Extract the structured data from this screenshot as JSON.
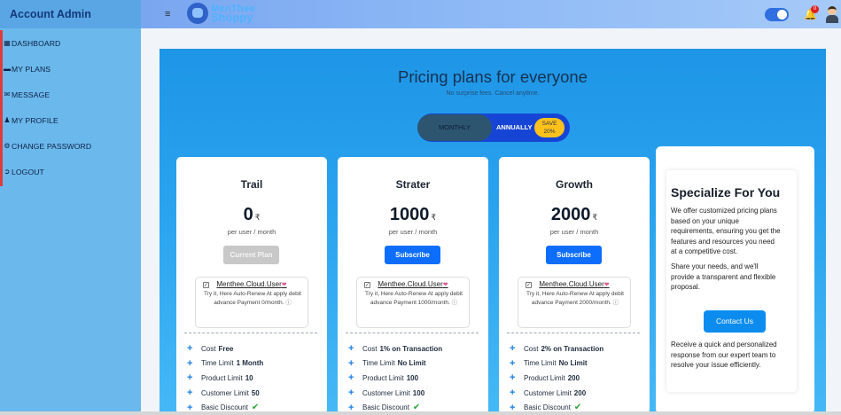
{
  "sidebar": {
    "title": "Account Admin",
    "items": [
      {
        "icon": "dashboard-icon",
        "label": "DASHBOARD"
      },
      {
        "icon": "card-icon",
        "label": "MY PLANS"
      },
      {
        "icon": "message-icon",
        "label": "MESSAGE"
      },
      {
        "icon": "user-icon",
        "label": "MY PROFILE"
      },
      {
        "icon": "gear-icon",
        "label": "CHANGE PASSWORD"
      },
      {
        "icon": "logout-icon",
        "label": "LOGOUT"
      }
    ]
  },
  "topbar": {
    "logo_line1": "MenThee",
    "logo_line2": "Shoppy",
    "notification_count": "0"
  },
  "pricing": {
    "headline": "Pricing plans for everyone",
    "subline": "No surprise fees. Cancel anytime.",
    "monthly_label": "MONTHLY",
    "annual_label": "ANNUALLY",
    "save_line1": "SAVE",
    "save_line2": "20%"
  },
  "plans": [
    {
      "name": "Trail",
      "price": "0",
      "currency": "₹",
      "per": "per user / month",
      "button": "Current Plan",
      "user_label": "Menthee.Cloud.User",
      "desc": "Try it, Here Auto-Renew At apply debit advance Payment 0/month.",
      "features": [
        {
          "label": "Cost",
          "value": "Free"
        },
        {
          "label": "Time Limit",
          "value": "1 Month"
        },
        {
          "label": "Product Limit",
          "value": "10"
        },
        {
          "label": "Customer Limit",
          "value": "50"
        },
        {
          "label": "Basic Discount",
          "value": ""
        }
      ]
    },
    {
      "name": "Strater",
      "price": "1000",
      "currency": "₹",
      "per": "per user / month",
      "button": "Subscribe",
      "user_label": "Menthee.Cloud.User",
      "desc": "Try it, Here Auto-Renew At apply debit advance Payment 1000/month.",
      "features": [
        {
          "label": "Cost",
          "value": "1% on Transaction"
        },
        {
          "label": "Time Limit",
          "value": "No Limit"
        },
        {
          "label": "Product Limit",
          "value": "100"
        },
        {
          "label": "Customer Limit",
          "value": "100"
        },
        {
          "label": "Basic Discount",
          "value": ""
        }
      ]
    },
    {
      "name": "Growth",
      "price": "2000",
      "currency": "₹",
      "per": "per user / month",
      "button": "Subscribe",
      "user_label": "Menthee.Cloud.User",
      "desc": "Try it, Here Auto-Renew At apply debit advance Payment 2000/month.",
      "features": [
        {
          "label": "Cost",
          "value": "2% on Transaction"
        },
        {
          "label": "Time Limit",
          "value": "No Limit"
        },
        {
          "label": "Product Limit",
          "value": "200"
        },
        {
          "label": "Customer Limit",
          "value": "200"
        },
        {
          "label": "Basic Discount",
          "value": ""
        }
      ]
    }
  ],
  "specialize": {
    "title": "Specialize For You",
    "p1": "We offer customized pricing plans based on your unique requirements, ensuring you get the features and resources you need at a competitive cost.",
    "p2": "Share your needs, and we'll provide a transparent and flexible proposal.",
    "button": "Contact Us",
    "p3": "Receive a quick and personalized response from our expert team to resolve your issue efficiently."
  }
}
